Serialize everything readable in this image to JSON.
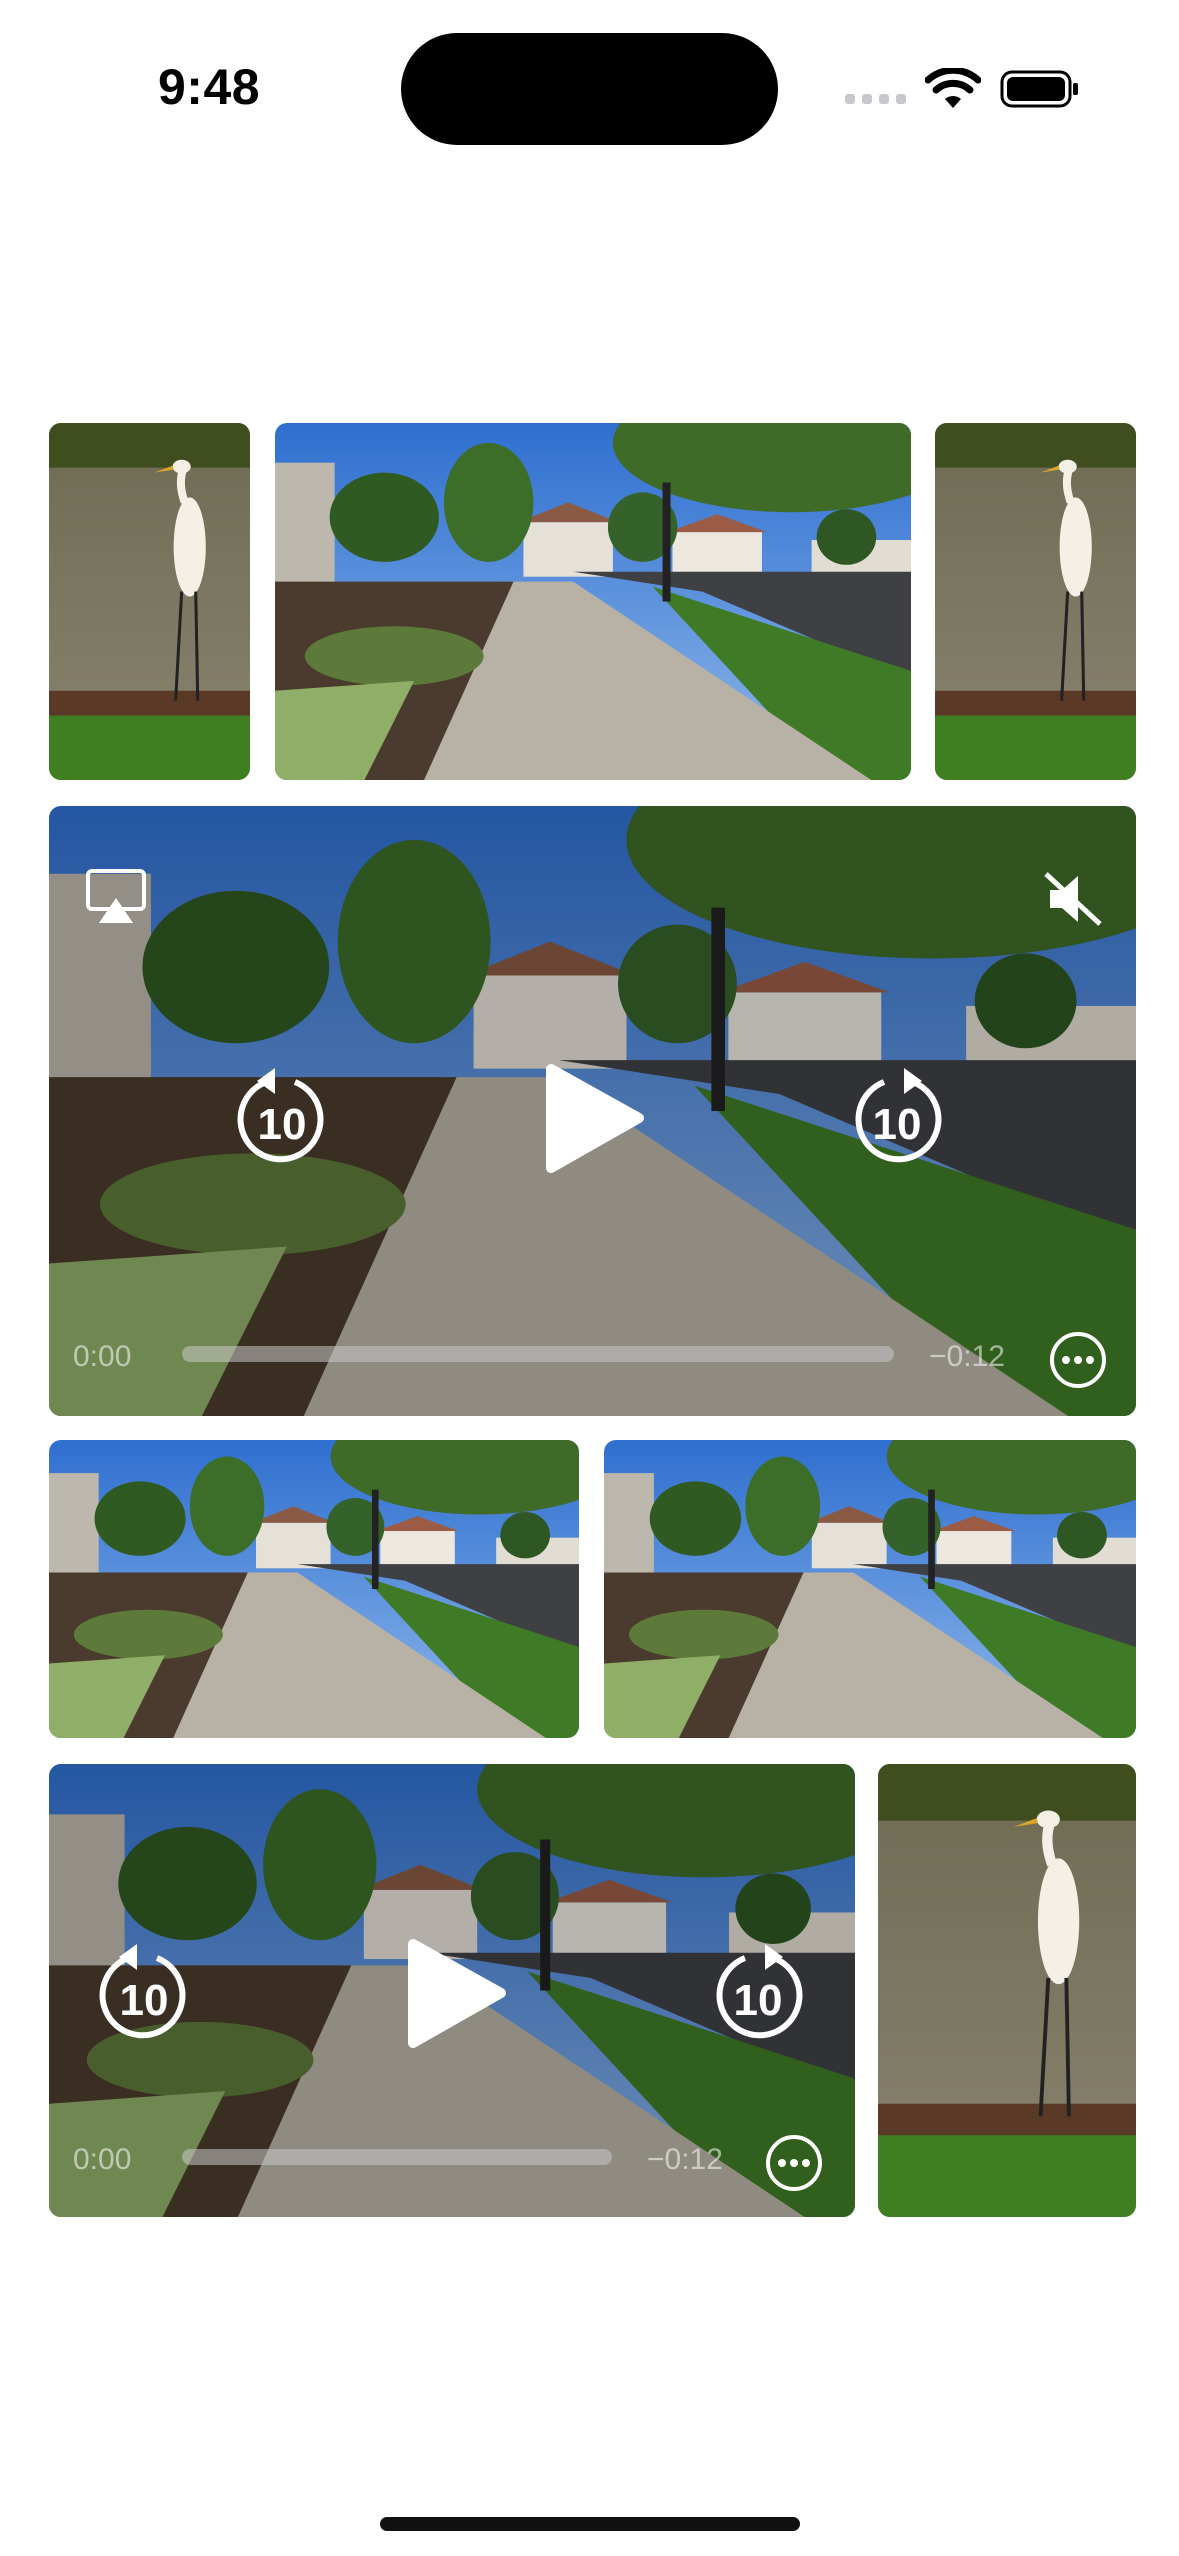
{
  "status_bar": {
    "time": "9:48"
  },
  "icons": {
    "wifi": "wifi-icon",
    "battery": "battery-icon",
    "airplay": "airplay-icon",
    "mute": "speaker-muted-icon",
    "skip_back": "skip-back-10-icon",
    "skip_forward": "skip-forward-10-icon",
    "play": "play-icon",
    "more": "more-options-icon"
  },
  "player_large": {
    "skip_back_label": "10",
    "skip_forward_label": "10",
    "elapsed": "0:00",
    "remaining": "−0:12",
    "progress": 0.0
  },
  "player_small": {
    "skip_back_label": "10",
    "skip_forward_label": "10",
    "elapsed": "0:00",
    "remaining": "−0:12",
    "progress": 0.0
  },
  "colors": {
    "background": "#ffffff",
    "sky": "#3d7bd6",
    "grass": "#5b8c2e",
    "sidewalk": "#b9b3a7"
  }
}
